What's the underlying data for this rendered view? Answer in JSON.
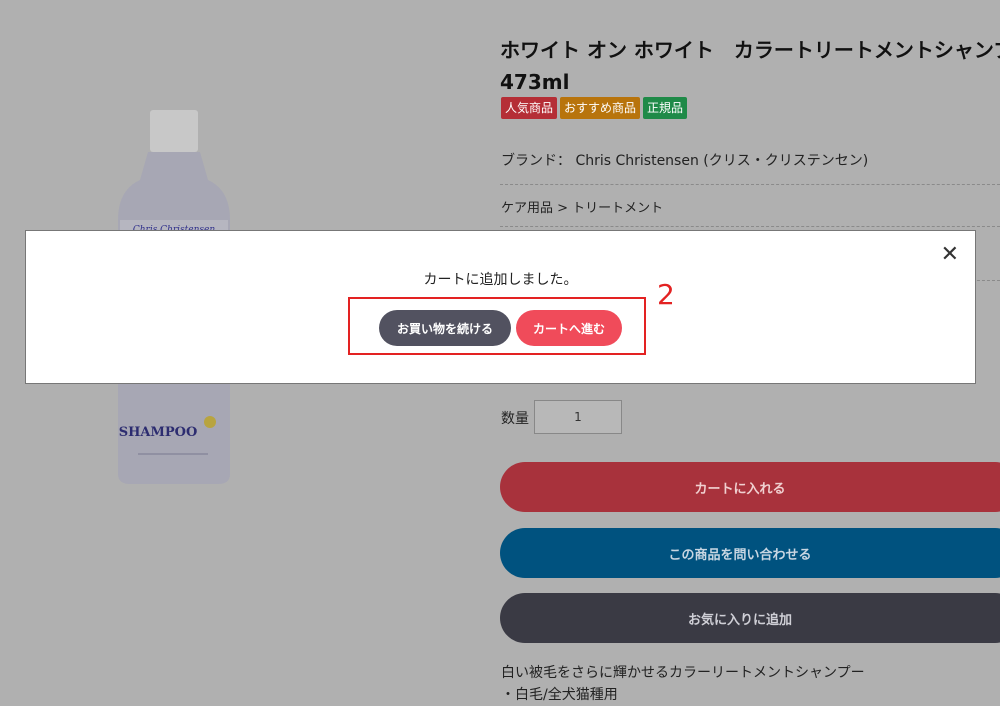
{
  "product": {
    "title_line1": "ホワイト オン ホワイト　カラートリートメントシャンプー",
    "title_line2": "473ml",
    "badges": [
      {
        "label": "人気商品",
        "color": "#b52e36"
      },
      {
        "label": "おすすめ商品",
        "color": "#b8740c"
      },
      {
        "label": "正規品",
        "color": "#1f8a48"
      }
    ],
    "brand_label": "ブランド：",
    "brand_value": "Chris Christensen (クリス・クリステンセン)",
    "category": "ケア用品 > トリートメント",
    "bottle_label": "SHAMPOO",
    "bottle_script": "Chris Christensen"
  },
  "purchase": {
    "qty_label": "数量",
    "qty_value": "1",
    "add_to_cart": "カートに入れる",
    "inquire": "この商品を問い合わせる",
    "favorite": "お気に入りに追加"
  },
  "description": {
    "line1": "白い被毛をさらに輝かせるカラーリートメントシャンプー",
    "line2": "・白毛/全犬猫種用"
  },
  "modal": {
    "message": "カートに追加しました。",
    "continue_label": "お買い物を続ける",
    "checkout_label": "カートへ進む",
    "annotation": "2"
  },
  "colors": {
    "overlay": "#b0b0b0",
    "continue_btn": "#525260",
    "checkout_btn": "#f04b5a",
    "highlight": "#e32222",
    "cart_btn_dim": "#a8323c",
    "inquire_btn_dim": "#00527f",
    "fav_btn_dim": "#3a3a44"
  }
}
